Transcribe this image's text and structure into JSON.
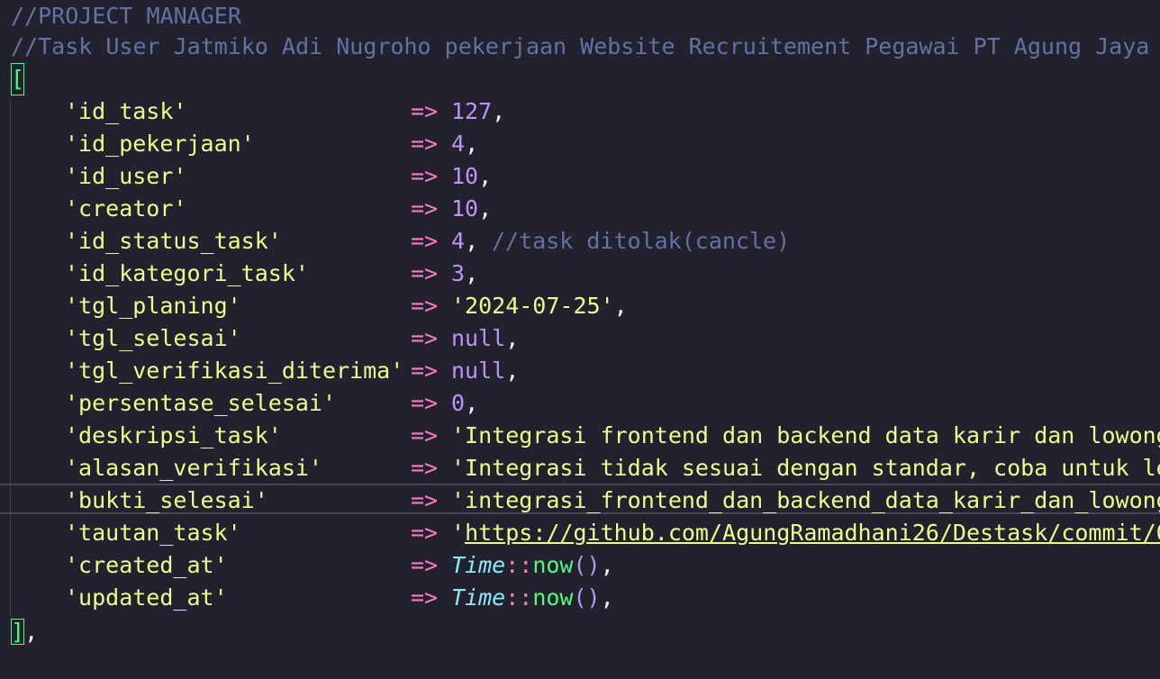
{
  "comments": {
    "header": "//PROJECT MANAGER",
    "task": "//Task User Jatmiko Adi Nugroho pekerjaan Website Recruitement Pegawai PT Agung Jaya M"
  },
  "open_bracket": "[",
  "close_bracket": "]",
  "close_comma": ",",
  "arrow": "=>",
  "rows": [
    {
      "key": "'id_task'",
      "value": "127",
      "suffix": ","
    },
    {
      "key": "'id_pekerjaan'",
      "value": "4",
      "suffix": ","
    },
    {
      "key": "'id_user'",
      "value": "10",
      "suffix": ","
    },
    {
      "key": "'creator'",
      "value": "10",
      "suffix": ","
    },
    {
      "key": "'id_status_task'",
      "value": "4",
      "suffix": ",",
      "comment": "//task ditolak(cancle)"
    },
    {
      "key": "'id_kategori_task'",
      "value": "3",
      "suffix": ","
    },
    {
      "key": "'tgl_planing'",
      "value": "'2024-07-25'",
      "suffix": ","
    },
    {
      "key": "'tgl_selesai'",
      "value": "null",
      "suffix": ","
    },
    {
      "key": "'tgl_verifikasi_diterima'",
      "value": "null",
      "suffix": ","
    },
    {
      "key": "'persentase_selesai'",
      "value": "0",
      "suffix": ","
    },
    {
      "key": "'deskripsi_task'",
      "value": "'Integrasi frontend dan backend data karir dan lowong"
    },
    {
      "key": "'alasan_verifikasi'",
      "value": "'Integrasi tidak sesuai dengan standar, coba untuk le"
    },
    {
      "key": "'bukti_selesai'",
      "value": "'integrasi_frontend_dan_backend_data_karir_dan_lowong"
    },
    {
      "key": "'tautan_task'",
      "quote": "'",
      "value": "https://github.com/AgungRamadhani26/Destask/commit/0"
    },
    {
      "key": "'created_at'",
      "cls": "Time",
      "op": "::",
      "fn": "now",
      "parens": "()",
      "suffix": ","
    },
    {
      "key": "'updated_at'",
      "cls": "Time",
      "op": "::",
      "fn": "now",
      "parens": "()",
      "suffix": ","
    }
  ],
  "colors": {
    "background": "#22222e",
    "comment": "#6272a4",
    "string": "#f1fa8c",
    "number": "#bd93f9",
    "arrow": "#ff79c6",
    "bracket": "#50fa7b",
    "class": "#8be9fd"
  }
}
